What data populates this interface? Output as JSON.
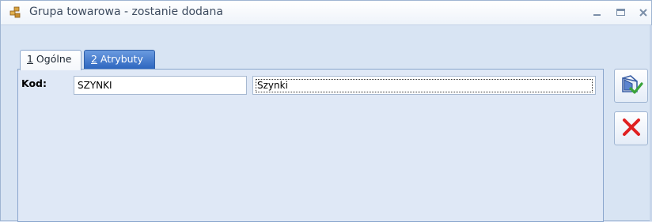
{
  "window": {
    "title": "Grupa towarowa - zostanie dodana",
    "icon": "stacked-goods-icon",
    "controls": [
      "minimize-icon",
      "maximize-icon",
      "close-icon"
    ]
  },
  "tabs": [
    {
      "key": "1",
      "label": " Ogólne",
      "active": true
    },
    {
      "key": "2",
      "label": " Atrybuty",
      "active": false
    }
  ],
  "form": {
    "kod_label": "Kod:",
    "kod_value": "SZYNKI",
    "name_value": "Szynki"
  },
  "actions": {
    "save_icon": "save-check-icon",
    "cancel_icon": "cancel-x-icon"
  },
  "colors": {
    "active_tab_bg": "#ffffff",
    "inactive_tab_bg": "#3a74cc",
    "panel_bg": "#dfe8f6",
    "cancel_red": "#e02020",
    "save_green": "#3aa33a"
  }
}
